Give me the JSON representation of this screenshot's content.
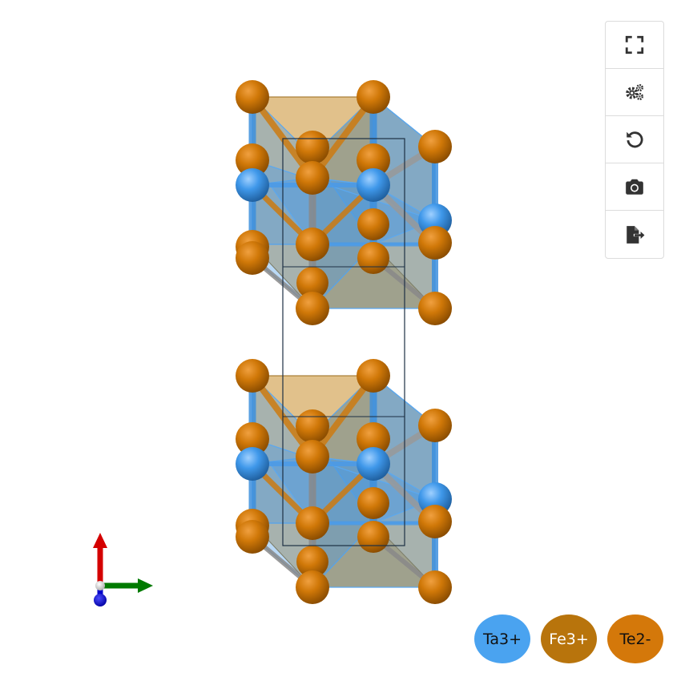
{
  "toolbar": {
    "buttons": [
      {
        "name": "fullscreen-button",
        "icon": "fullscreen-icon"
      },
      {
        "name": "settings-button",
        "icon": "gears-icon"
      },
      {
        "name": "reset-view-button",
        "icon": "reset-icon"
      },
      {
        "name": "screenshot-button",
        "icon": "camera-icon"
      },
      {
        "name": "export-button",
        "icon": "export-file-icon"
      }
    ],
    "icon_color": "#333333"
  },
  "legend": [
    {
      "label": "Ta3+",
      "color": "#4aa3f0",
      "text_color": "#111111"
    },
    {
      "label": "Fe3+",
      "color": "#b8740c",
      "text_color": "#ffffff"
    },
    {
      "label": "Te2-",
      "color": "#d4780a",
      "text_color": "#111111"
    }
  ],
  "axes": {
    "a_color": "#d40000",
    "b_color": "#007a00",
    "c_color": "#0000cc"
  },
  "structure": {
    "polyhedron_blue": "#4a9ae8",
    "polyhedron_tan": "#c98e2c",
    "atom_orange": "#cc7000",
    "atom_blue": "#3d97e8",
    "cell_line": "#1d3044"
  }
}
